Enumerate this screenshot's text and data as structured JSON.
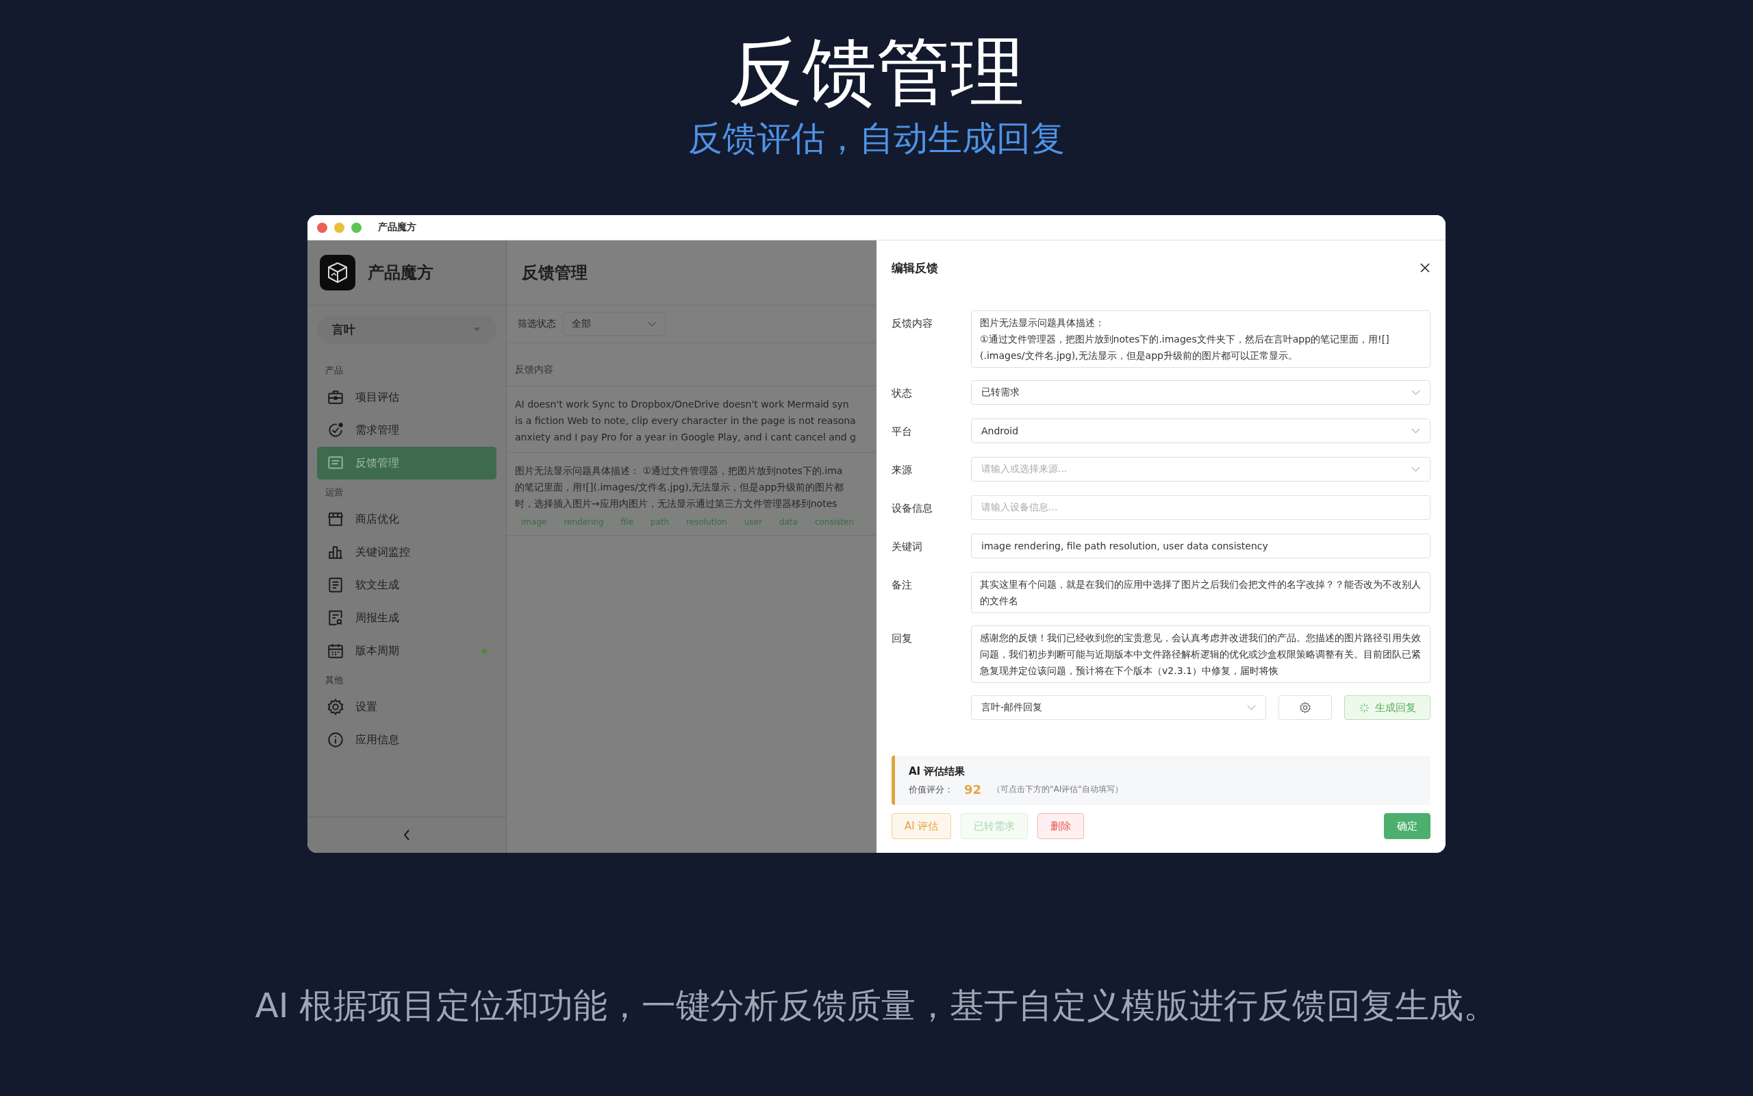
{
  "header": {
    "title": "反馈管理",
    "subtitle": "反馈评估，自动生成回复"
  },
  "window": {
    "title": "产品魔方"
  },
  "sidebar": {
    "app_name": "产品魔方",
    "workspace": "言叶",
    "sections": [
      {
        "label": "产品",
        "items": [
          {
            "label": "项目评估",
            "selected": false,
            "dot": false
          },
          {
            "label": "需求管理",
            "selected": false,
            "dot": false
          },
          {
            "label": "反馈管理",
            "selected": true,
            "dot": false
          }
        ]
      },
      {
        "label": "运营",
        "items": [
          {
            "label": "商店优化",
            "selected": false,
            "dot": false
          },
          {
            "label": "关键词监控",
            "selected": false,
            "dot": false
          },
          {
            "label": "软文生成",
            "selected": false,
            "dot": false
          },
          {
            "label": "周报生成",
            "selected": false,
            "dot": false
          },
          {
            "label": "版本周期",
            "selected": false,
            "dot": true
          }
        ]
      },
      {
        "label": "其他",
        "items": [
          {
            "label": "设置",
            "selected": false,
            "dot": false
          },
          {
            "label": "应用信息",
            "selected": false,
            "dot": false
          }
        ]
      }
    ]
  },
  "main": {
    "title": "反馈管理",
    "filter": {
      "label": "筛选状态",
      "value": "全部"
    },
    "column": "反馈内容",
    "rows": [
      {
        "lines": [
          "AI doesn't work Sync to Dropbox/OneDrive doesn't work  Mermaid syn",
          "is a fiction Web to note, clip every character in the page is not reasona",
          "anxiety and I pay Pro for a year in Google Play, and i cant cancel and g"
        ],
        "tags": []
      },
      {
        "lines": [
          "图片无法显示问题具体描述：  ①通过文件管理器，把图片放到notes下的.ima",
          "的笔记里面，用![](.images/文件名.jpg),无法显示，但是app升级前的图片都",
          "时，选择插入图片→应用内图片，无法显示通过第三方文件管理器移到notes"
        ],
        "tags": [
          "image",
          "rendering",
          "file",
          "path",
          "resolution",
          "user",
          "data",
          "consisten"
        ]
      }
    ]
  },
  "drawer": {
    "title": "编辑反馈",
    "fields": [
      {
        "label": "反馈内容",
        "kind": "textarea",
        "value": "图片无法显示问题具体描述：\n①通过文件管理器，把图片放到notes下的.images文件夹下，然后在言叶app的笔记里面，用![](.images/文件名.jpg),无法显示，但是app升级前的图片都可以正常显示。"
      },
      {
        "label": "状态",
        "kind": "select",
        "value": "已转需求"
      },
      {
        "label": "平台",
        "kind": "select",
        "value": "Android"
      },
      {
        "label": "来源",
        "kind": "select",
        "placeholder": "请输入或选择来源..."
      },
      {
        "label": "设备信息",
        "kind": "input",
        "placeholder": "请输入设备信息..."
      },
      {
        "label": "关键词",
        "kind": "input",
        "value": "image rendering, file path resolution, user data consistency"
      },
      {
        "label": "备注",
        "kind": "textarea",
        "value": "其实这里有个问题，就是在我们的应用中选择了图片之后我们会把文件的名字改掉？？能否改为不改别人的文件名"
      },
      {
        "label": "回复",
        "kind": "textarea",
        "value": "感谢您的反馈！我们已经收到您的宝贵意见，会认真考虑并改进我们的产品。您描述的图片路径引用失效问题，我们初步判断可能与近期版本中文件路径解析逻辑的优化或沙盒权限策略调整有关。目前团队已紧急复现并定位该问题，预计将在下个版本（v2.3.1）中修复，届时将恢"
      }
    ],
    "template": "言叶-邮件回复",
    "generate": "生成回复",
    "ai_result": {
      "title": "AI 评估结果",
      "score_label": "价值评分：",
      "score": "92",
      "hint": "（可点击下方的\"AI评估\"自动填写）"
    },
    "buttons": [
      {
        "label": "AI 评估",
        "kind": "warning",
        "disabled": false
      },
      {
        "label": "已转需求",
        "kind": "success",
        "disabled": true
      },
      {
        "label": "删除",
        "kind": "danger",
        "disabled": false
      },
      {
        "label": "确定",
        "kind": "primary",
        "disabled": false
      }
    ]
  },
  "caption": "AI 根据项目定位和功能，一键分析反馈质量，基于自定义模版进行反馈回复生成。"
}
